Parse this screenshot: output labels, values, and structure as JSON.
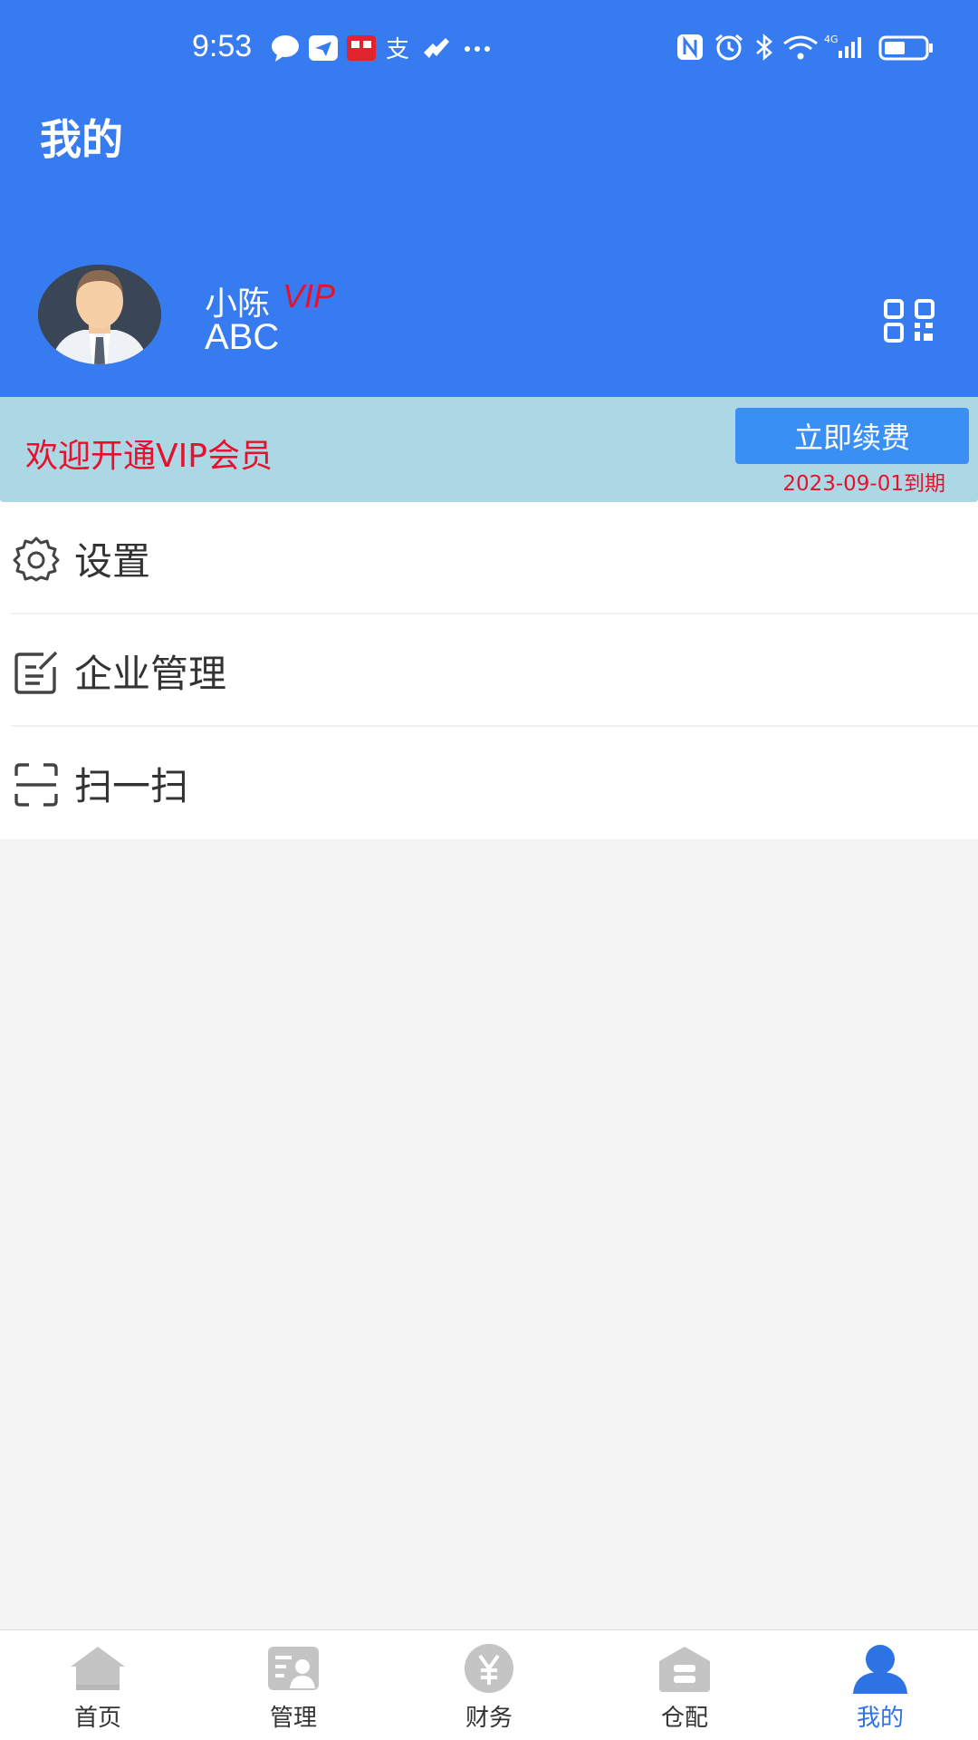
{
  "status_bar": {
    "time": "9:53"
  },
  "header": {
    "title": "我的"
  },
  "profile": {
    "name": "小陈",
    "vip_tag": "VIP",
    "org": "ABC"
  },
  "vip_banner": {
    "welcome": "欢迎开通VIP会员",
    "renew_label": "立即续费",
    "expire_text": "2023-09-01到期"
  },
  "menu": {
    "items": [
      {
        "label": "设置",
        "icon": "gear-icon"
      },
      {
        "label": "企业管理",
        "icon": "edit-icon"
      },
      {
        "label": "扫一扫",
        "icon": "scan-icon"
      }
    ]
  },
  "tabbar": {
    "tabs": [
      {
        "label": "首页",
        "icon": "home-icon"
      },
      {
        "label": "管理",
        "icon": "manage-icon"
      },
      {
        "label": "财务",
        "icon": "yen-icon"
      },
      {
        "label": "仓配",
        "icon": "warehouse-icon"
      },
      {
        "label": "我的",
        "icon": "user-icon",
        "active": true
      }
    ]
  },
  "colors": {
    "header_bg": "#377bf0",
    "vip_red": "#e8112d",
    "banner_bg": "#acd8e6",
    "renew_button": "#3a8ff5",
    "tab_active": "#2e73e3",
    "tab_inactive_icon": "#c4c4c4"
  }
}
